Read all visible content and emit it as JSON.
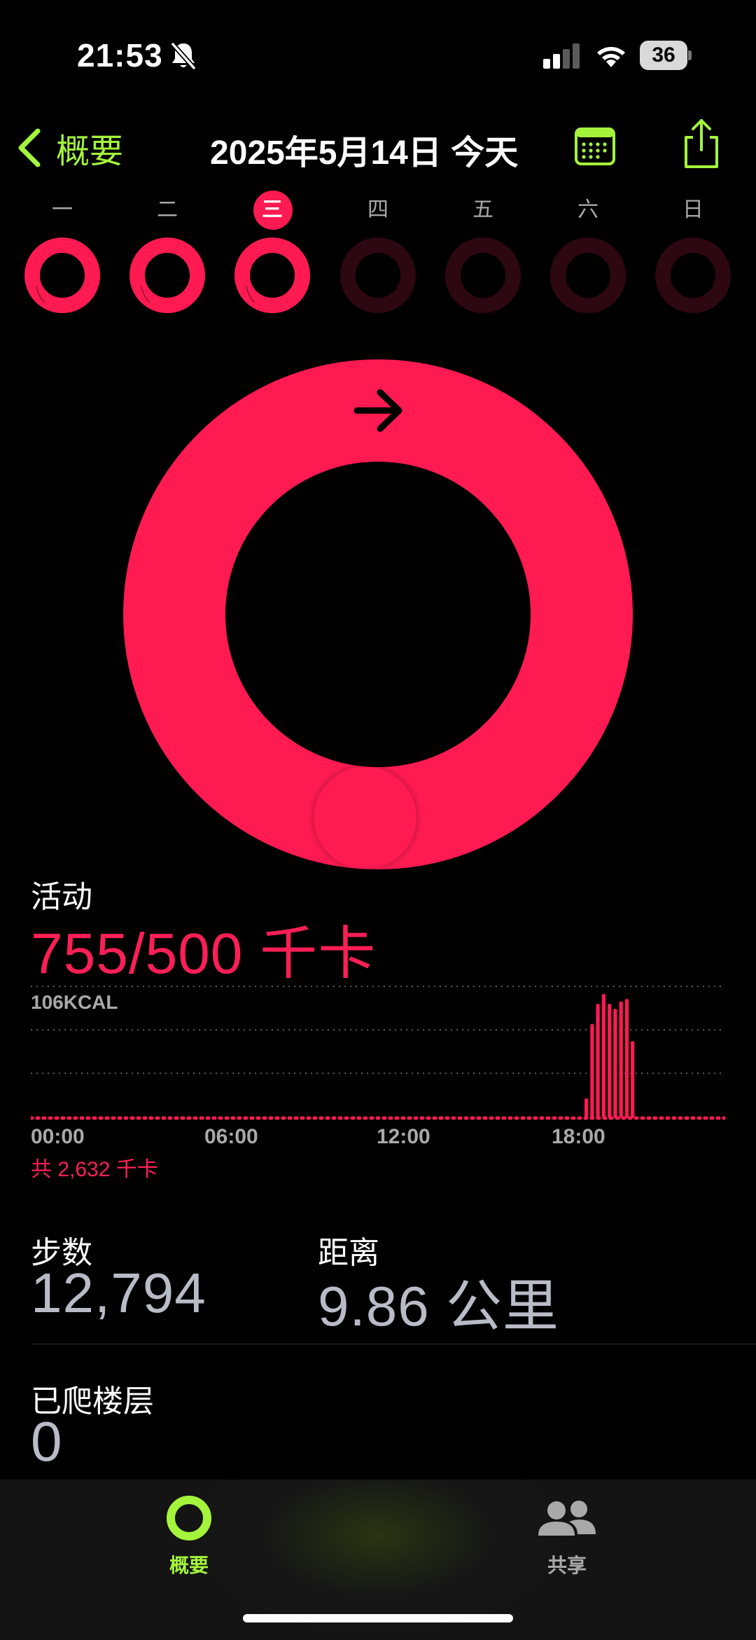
{
  "status_bar": {
    "time": "21:53",
    "battery": "36"
  },
  "nav": {
    "back_label": "概要",
    "title": "2025年5月14日 今天"
  },
  "week": {
    "days": [
      "一",
      "二",
      "三",
      "四",
      "五",
      "六",
      "日"
    ],
    "current_index": 2,
    "progress": [
      1.0,
      1.0,
      1.0,
      0,
      0,
      0,
      0
    ]
  },
  "move_ring": {
    "progress": 1.51
  },
  "activity": {
    "label": "活动",
    "value": "755/500 千卡",
    "chart_label": "106KCAL",
    "total": "共 2,632 千卡"
  },
  "chart_data": {
    "type": "bar",
    "y_max_label": "106KCAL",
    "ylim": [
      0,
      106
    ],
    "x_ticks": [
      "00:00",
      "06:00",
      "12:00",
      "18:00"
    ],
    "hours_range": [
      0,
      24
    ],
    "points": [
      {
        "hour": 19.2,
        "kcal": 16
      },
      {
        "hour": 19.4,
        "kcal": 76
      },
      {
        "hour": 19.6,
        "kcal": 92
      },
      {
        "hour": 19.8,
        "kcal": 100
      },
      {
        "hour": 20.0,
        "kcal": 92
      },
      {
        "hour": 20.2,
        "kcal": 88
      },
      {
        "hour": 20.4,
        "kcal": 94
      },
      {
        "hour": 20.6,
        "kcal": 96
      },
      {
        "hour": 20.8,
        "kcal": 62
      }
    ]
  },
  "stats": {
    "steps": {
      "label": "步数",
      "value": "12,794"
    },
    "distance": {
      "label": "距离",
      "value": "9.86 公里"
    },
    "floors": {
      "label": "已爬楼层",
      "value": "0"
    }
  },
  "tabs": [
    {
      "label": "概要",
      "icon": "activity-ring-icon",
      "active": true
    },
    {
      "label": "共享",
      "icon": "people-icon",
      "active": false
    }
  ],
  "colors": {
    "move": "#ff1a52",
    "accent": "#a4f43c",
    "inactive": "#a9a9a9"
  }
}
